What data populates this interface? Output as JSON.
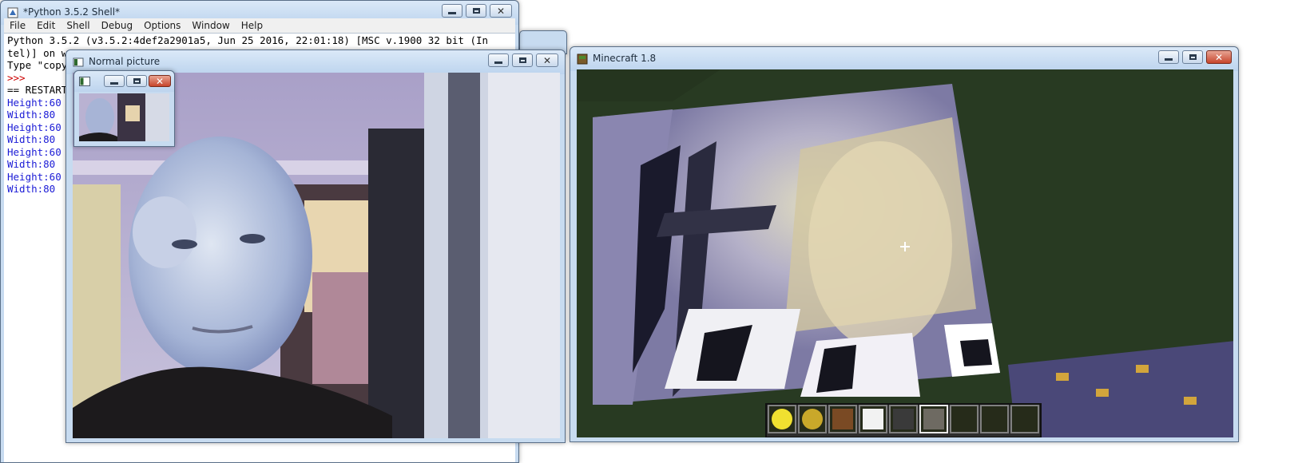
{
  "shell": {
    "title": "*Python 3.5.2 Shell*",
    "menu": [
      "File",
      "Edit",
      "Shell",
      "Debug",
      "Options",
      "Window",
      "Help"
    ],
    "lines": [
      {
        "text": "Python 3.5.2 (v3.5.2:4def2a2901a5, Jun 25 2016, 22:01:18) [MSC v.1900 32 bit (In",
        "color": "black"
      },
      {
        "text": "tel)] on w",
        "color": "black"
      },
      {
        "text": "Type \"copy",
        "color": "black"
      },
      {
        "text": ">>>",
        "color": "red"
      },
      {
        "text": "== RESTART",
        "color": "black"
      },
      {
        "text": "Height:60",
        "color": "blue"
      },
      {
        "text": "Width:80",
        "color": "blue"
      },
      {
        "text": "Height:60",
        "color": "blue"
      },
      {
        "text": "Width:80",
        "color": "blue"
      },
      {
        "text": "Height:60",
        "color": "blue"
      },
      {
        "text": "Width:80",
        "color": "blue"
      },
      {
        "text": "Height:60",
        "color": "blue"
      },
      {
        "text": "Width:80",
        "color": "blue"
      }
    ]
  },
  "normal_picture": {
    "title": "Normal picture"
  },
  "minecraft": {
    "title": "Minecraft 1.8",
    "hotbar": [
      "clock-gold",
      "clock",
      "book",
      "snow-block",
      "bedrock",
      "gravel",
      "empty",
      "empty",
      "empty"
    ],
    "selected_slot": 5
  },
  "colors": {
    "titlebar": "#c7dbf0",
    "close": "#c7452c",
    "console_blue": "#1b1bd6",
    "console_red": "#c00000"
  }
}
